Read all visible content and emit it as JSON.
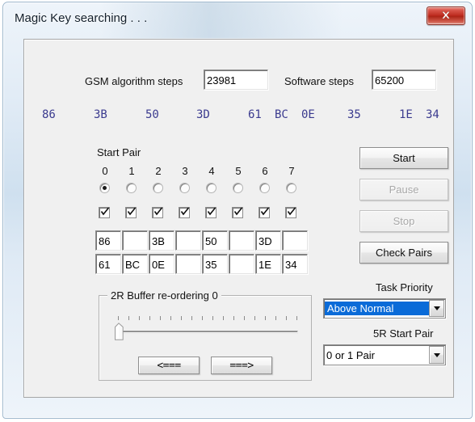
{
  "window": {
    "title": "Magic Key searching . . .",
    "close_icon": "close-x-icon"
  },
  "stats": {
    "gsm_label": "GSM algorithm steps",
    "gsm_value": "23981",
    "software_label": "Software steps",
    "software_value": "65200"
  },
  "key_readout": {
    "values": [
      "86",
      "3B",
      "50",
      "3D",
      "61",
      "BC",
      "0E",
      "35",
      "1E",
      "34"
    ],
    "color": "#3b3b8f"
  },
  "start_pair": {
    "label": "Start Pair",
    "column_numbers": [
      "0",
      "1",
      "2",
      "3",
      "4",
      "5",
      "6",
      "7"
    ],
    "selected_radio": 0,
    "checkboxes": [
      true,
      true,
      true,
      true,
      true,
      true,
      true,
      true
    ],
    "byte_row_1": [
      "86",
      "",
      "3B",
      "",
      "50",
      "",
      "3D",
      ""
    ],
    "byte_row_2": [
      "61",
      "BC",
      "0E",
      "",
      "35",
      "",
      "1E",
      "34"
    ]
  },
  "actions": {
    "start": "Start",
    "pause": "Pause",
    "stop": "Stop",
    "check_pairs": "Check Pairs"
  },
  "task_priority": {
    "label": "Task Priority",
    "value": "Above Normal",
    "highlight_color": "#0a6bd8"
  },
  "start_pair_5r": {
    "label": "5R Start Pair",
    "value": "0 or 1 Pair"
  },
  "buffer_group": {
    "title": "2R Buffer re-ordering 0",
    "slider_value": 0,
    "tick_count": 18,
    "prev_button": "<===",
    "next_button": "===>"
  }
}
